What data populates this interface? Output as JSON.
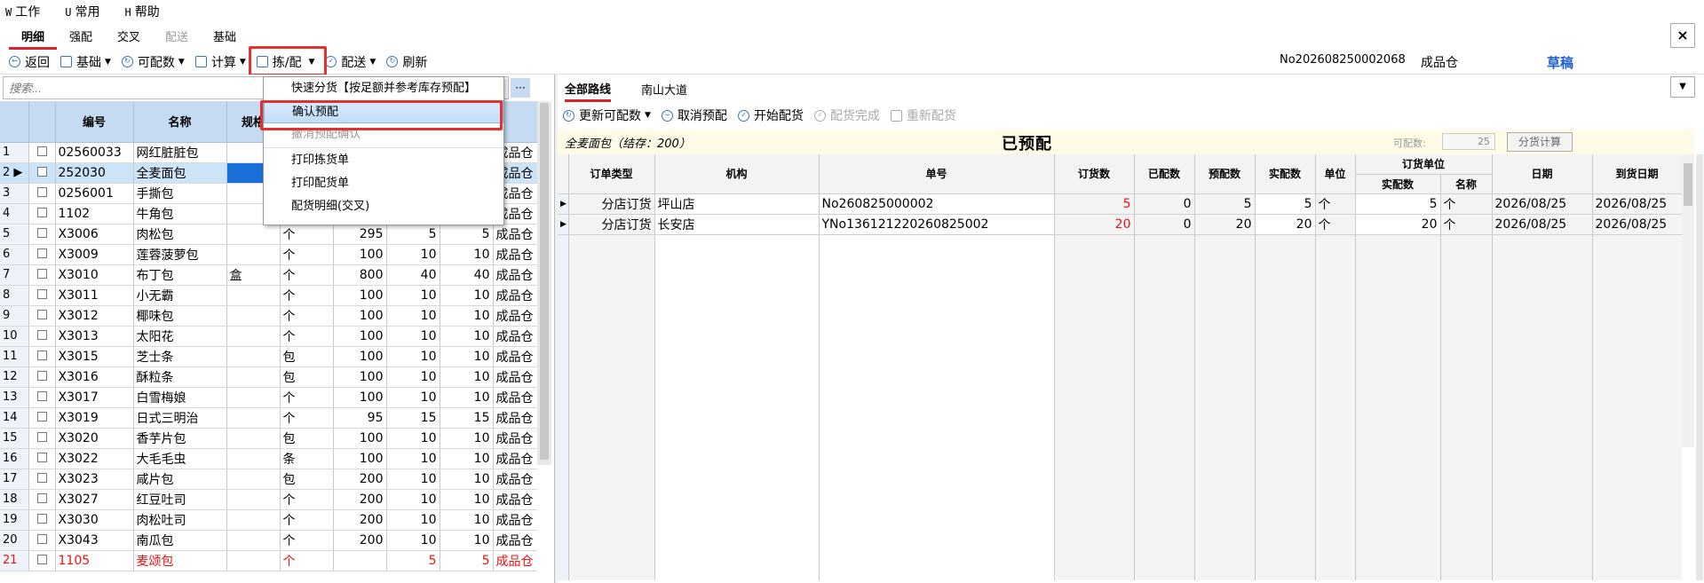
{
  "menubar": [
    {
      "key": "W",
      "label": "工作"
    },
    {
      "key": "U",
      "label": "常用"
    },
    {
      "key": "H",
      "label": "帮助"
    }
  ],
  "tabs": [
    {
      "label": "明细",
      "active": true
    },
    {
      "label": "强配",
      "active": false
    },
    {
      "label": "交叉",
      "active": false
    },
    {
      "label": "配送",
      "active": false,
      "dim": true
    },
    {
      "label": "基础",
      "active": false
    }
  ],
  "close_label": "×",
  "toolbar": {
    "back": "返回",
    "basic": "基础",
    "available": "可配数",
    "calc": "计算",
    "pick": "拣/配",
    "deliver": "配送",
    "refresh": "刷新"
  },
  "header": {
    "doc_no": "No202608250002068",
    "warehouse": "成品仓",
    "status_badge": "草稿",
    "status_color": "#1e5fcf"
  },
  "search": {
    "placeholder": "搜索..."
  },
  "more_icon": "···",
  "left_table": {
    "columns": [
      "",
      "",
      "编号",
      "名称",
      "规格",
      "",
      "",
      "",
      "",
      ""
    ],
    "rows": [
      {
        "n": "1",
        "code": "02560033",
        "name": "网红脏脏包",
        "spec": "",
        "unit": "",
        "a": "",
        "b": "",
        "c": "",
        "wh": "成品仓"
      },
      {
        "n": "2",
        "code": "252030",
        "name": "全麦面包",
        "spec": "",
        "unit": "",
        "a": "",
        "b": "",
        "c": "",
        "wh": "成品仓",
        "selected": true
      },
      {
        "n": "3",
        "code": "0256001",
        "name": "手撕包",
        "spec": "",
        "unit": "",
        "a": "",
        "b": "",
        "c": "",
        "wh": "成品仓"
      },
      {
        "n": "4",
        "code": "1102",
        "name": "牛角包",
        "spec": "",
        "unit": "",
        "a": "",
        "b": "",
        "c": "",
        "wh": "成品仓"
      },
      {
        "n": "5",
        "code": "X3006",
        "name": "肉松包",
        "spec": "",
        "unit": "个",
        "a": "295",
        "b": "5",
        "c": "5",
        "wh": "成品仓"
      },
      {
        "n": "6",
        "code": "X3009",
        "name": "莲蓉菠萝包",
        "spec": "",
        "unit": "个",
        "a": "100",
        "b": "10",
        "c": "10",
        "wh": "成品仓"
      },
      {
        "n": "7",
        "code": "X3010",
        "name": "布丁包",
        "spec": "盒",
        "unit": "个",
        "a": "800",
        "b": "40",
        "c": "40",
        "wh": "成品仓"
      },
      {
        "n": "8",
        "code": "X3011",
        "name": "小无霸",
        "spec": "",
        "unit": "个",
        "a": "100",
        "b": "10",
        "c": "10",
        "wh": "成品仓"
      },
      {
        "n": "9",
        "code": "X3012",
        "name": "椰味包",
        "spec": "",
        "unit": "个",
        "a": "100",
        "b": "10",
        "c": "10",
        "wh": "成品仓"
      },
      {
        "n": "10",
        "code": "X3013",
        "name": "太阳花",
        "spec": "",
        "unit": "个",
        "a": "100",
        "b": "10",
        "c": "10",
        "wh": "成品仓"
      },
      {
        "n": "11",
        "code": "X3015",
        "name": "芝士条",
        "spec": "",
        "unit": "包",
        "a": "100",
        "b": "10",
        "c": "10",
        "wh": "成品仓"
      },
      {
        "n": "12",
        "code": "X3016",
        "name": "酥粒条",
        "spec": "",
        "unit": "包",
        "a": "100",
        "b": "10",
        "c": "10",
        "wh": "成品仓"
      },
      {
        "n": "13",
        "code": "X3017",
        "name": "白雪梅娘",
        "spec": "",
        "unit": "个",
        "a": "100",
        "b": "10",
        "c": "10",
        "wh": "成品仓"
      },
      {
        "n": "14",
        "code": "X3019",
        "name": "日式三明治",
        "spec": "",
        "unit": "个",
        "a": "95",
        "b": "15",
        "c": "15",
        "wh": "成品仓"
      },
      {
        "n": "15",
        "code": "X3020",
        "name": "香芋片包",
        "spec": "",
        "unit": "包",
        "a": "100",
        "b": "10",
        "c": "10",
        "wh": "成品仓"
      },
      {
        "n": "16",
        "code": "X3022",
        "name": "大毛毛虫",
        "spec": "",
        "unit": "条",
        "a": "100",
        "b": "10",
        "c": "10",
        "wh": "成品仓"
      },
      {
        "n": "17",
        "code": "X3023",
        "name": "咸片包",
        "spec": "",
        "unit": "包",
        "a": "200",
        "b": "10",
        "c": "10",
        "wh": "成品仓"
      },
      {
        "n": "18",
        "code": "X3027",
        "name": "红豆吐司",
        "spec": "",
        "unit": "个",
        "a": "200",
        "b": "10",
        "c": "10",
        "wh": "成品仓"
      },
      {
        "n": "19",
        "code": "X3030",
        "name": "肉松吐司",
        "spec": "",
        "unit": "个",
        "a": "200",
        "b": "10",
        "c": "10",
        "wh": "成品仓"
      },
      {
        "n": "20",
        "code": "X3043",
        "name": "南瓜包",
        "spec": "",
        "unit": "个",
        "a": "200",
        "b": "10",
        "c": "10",
        "wh": "成品仓"
      },
      {
        "n": "21",
        "code": "1105",
        "name": "麦颂包",
        "spec": "",
        "unit": "个",
        "a": "",
        "b": "5",
        "c": "5",
        "wh": "成品仓",
        "red": true
      }
    ]
  },
  "dropdown_menu": [
    {
      "label": "快速分货【按足额并参考库存预配】",
      "state": "normal"
    },
    {
      "label": "确认预配",
      "state": "highlighted"
    },
    {
      "label": "撤消预配确认",
      "state": "disabled"
    },
    {
      "label": "打印拣货单",
      "state": "normal"
    },
    {
      "label": "打印配货单",
      "state": "normal"
    },
    {
      "label": "配货明细(交叉)",
      "state": "normal"
    }
  ],
  "right": {
    "tabs": [
      {
        "label": "全部路线",
        "active": true
      },
      {
        "label": "南山大道",
        "active": false
      }
    ],
    "toolbar": {
      "update": "更新可配数",
      "cancel": "取消预配",
      "start": "开始配货",
      "done": "配货完成",
      "redo": "重新配货"
    },
    "product": "全麦面包（结存：200）",
    "status": "已预配",
    "avail_label": "可配数:",
    "avail_value": "25",
    "calc_button": "分货计算",
    "columns": {
      "order_type": "订单类型",
      "org": "机构",
      "order_no": "单号",
      "ordered": "订货数",
      "shipped": "已配数",
      "pre": "预配数",
      "actual": "实配数",
      "unit": "单位",
      "order_unit": "订货单位",
      "ou_actual": "实配数",
      "ou_name": "名称",
      "date": "日期",
      "arrive": "到货日期"
    },
    "rows": [
      {
        "type": "分店订货",
        "org": "坪山店",
        "no": "No260825000002",
        "ordered": "5",
        "shipped": "0",
        "pre": "5",
        "actual": "5",
        "unit": "个",
        "ou_actual": "5",
        "ou_name": "个",
        "date": "2026/08/25",
        "arrive": "2026/08/25"
      },
      {
        "type": "分店订货",
        "org": "长安店",
        "no": "YNo136121220260825002",
        "ordered": "20",
        "shipped": "0",
        "pre": "20",
        "actual": "20",
        "unit": "个",
        "ou_actual": "20",
        "ou_name": "个",
        "date": "2026/08/25",
        "arrive": "2026/08/25"
      }
    ]
  }
}
